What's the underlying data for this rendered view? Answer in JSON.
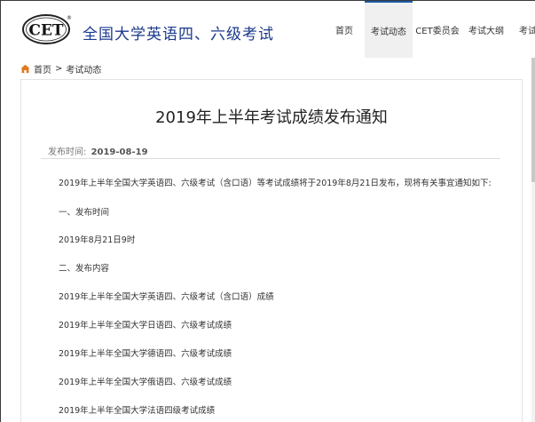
{
  "header": {
    "logo_text": "CET",
    "logo_mark": "®",
    "site_title": "全国大学英语四、六级考试",
    "nav": [
      {
        "label": "首页",
        "active": false
      },
      {
        "label": "考试动态",
        "active": true
      },
      {
        "label": "CET委员会",
        "active": false
      },
      {
        "label": "考试大纲",
        "active": false
      },
      {
        "label": "考试",
        "active": false
      }
    ]
  },
  "breadcrumb": {
    "home": "首页",
    "separator": ">",
    "current": "考试动态"
  },
  "article": {
    "title": "2019年上半年考试成绩发布通知",
    "publish_label": "发布时间:",
    "publish_date": "2019-08-19",
    "paragraphs": [
      "2019年上半年全国大学英语四、六级考试（含口语）等考试成绩将于2019年8月21日发布，现将有关事宜通知如下:",
      "一、发布时间",
      "2019年8月21日9时",
      "二、发布内容",
      "2019年上半年全国大学英语四、六级考试（含口语）成绩",
      "2019年上半年全国大学日语四、六级考试成绩",
      "2019年上半年全国大学德语四、六级考试成绩",
      "2019年上半年全国大学俄语四、六级考试成绩",
      "2019年上半年全国大学法语四级考试成绩"
    ]
  },
  "colors": {
    "brand_blue": "#1b3a8c",
    "nav_active_border": "#1a5aa8",
    "home_icon": "#e07a1f"
  },
  "icons": {
    "breadcrumb_home": "home-icon"
  }
}
